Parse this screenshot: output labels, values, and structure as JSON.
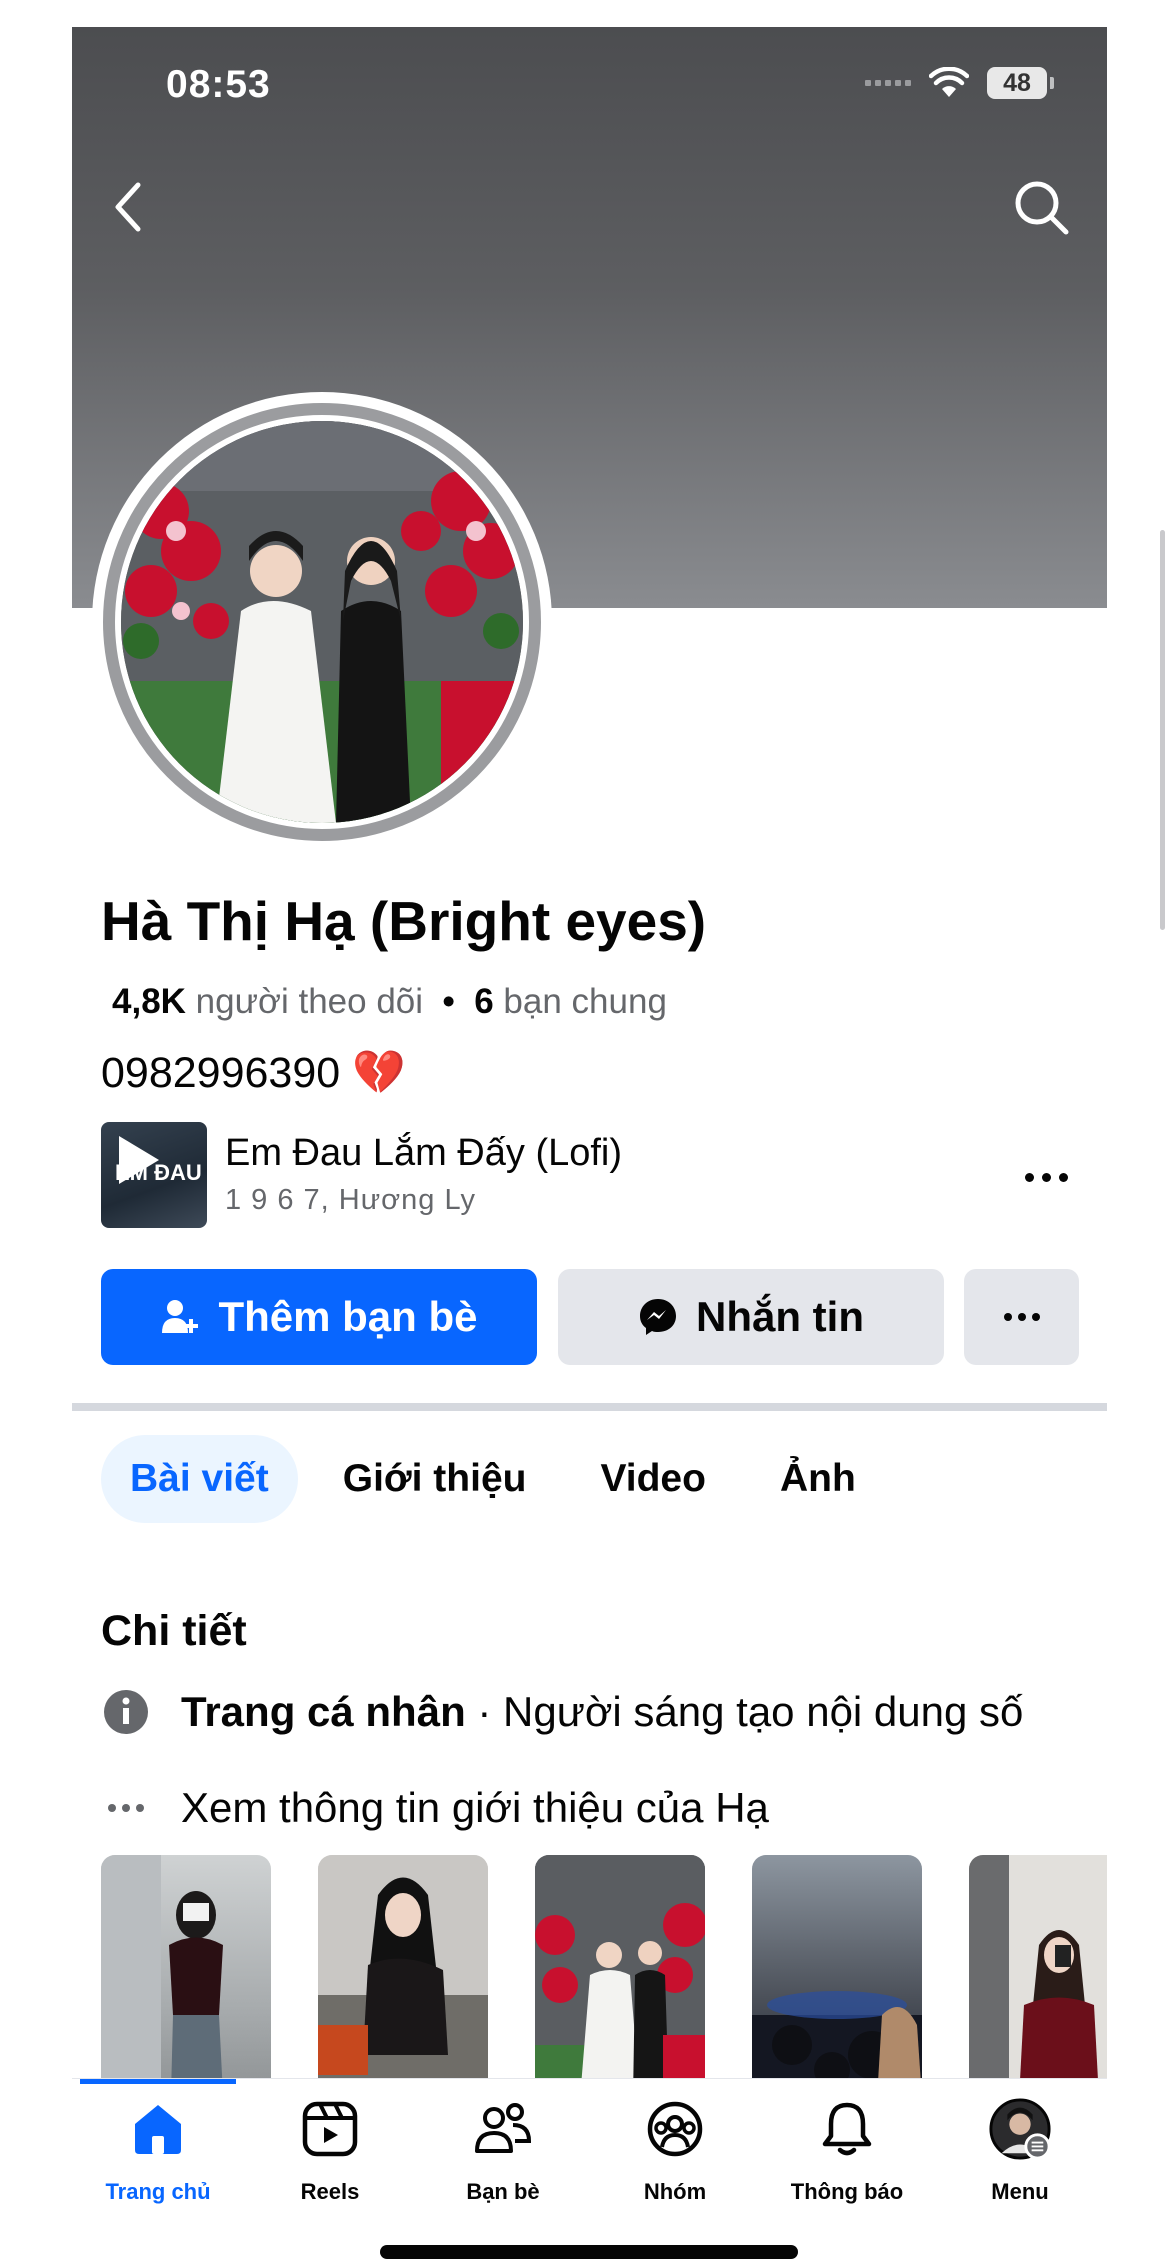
{
  "status_bar": {
    "time": "08:53",
    "battery": "48"
  },
  "profile": {
    "name": "Hà Thị Hạ (Bright eyes)",
    "followers_count": "4,8K",
    "followers_label": "người theo dõi",
    "separator": "•",
    "mutual_count": "6",
    "mutual_label": "bạn chung",
    "bio": "0982996390",
    "bio_emoji": "💔"
  },
  "music": {
    "title": "Em Đau Lắm Đấy (Lofi)",
    "subtitle": "1 9 6 7, Hương Ly",
    "thumb_text": "EM ĐAU"
  },
  "actions": {
    "add_friend": "Thêm bạn bè",
    "message": "Nhắn tin"
  },
  "tabs": [
    {
      "label": "Bài viết",
      "active": true
    },
    {
      "label": "Giới thiệu",
      "active": false
    },
    {
      "label": "Video",
      "active": false
    },
    {
      "label": "Ảnh",
      "active": false
    }
  ],
  "details": {
    "title": "Chi tiết",
    "page_type_bold": "Trang cá nhân",
    "page_type_rest": " · Người sáng tạo nội dung số",
    "see_about": "Xem thông tin giới thiệu của Hạ"
  },
  "bottom_nav": [
    {
      "label": "Trang chủ",
      "icon": "home-icon",
      "active": true
    },
    {
      "label": "Reels",
      "icon": "reels-icon",
      "active": false
    },
    {
      "label": "Bạn bè",
      "icon": "friends-icon",
      "active": false
    },
    {
      "label": "Nhóm",
      "icon": "groups-icon",
      "active": false
    },
    {
      "label": "Thông báo",
      "icon": "bell-icon",
      "active": false
    },
    {
      "label": "Menu",
      "icon": "menu-avatar-icon",
      "active": false
    }
  ],
  "colors": {
    "accent": "#0866ff",
    "secondary_button": "#e4e6eb",
    "tab_active_bg": "#ebf5ff"
  }
}
